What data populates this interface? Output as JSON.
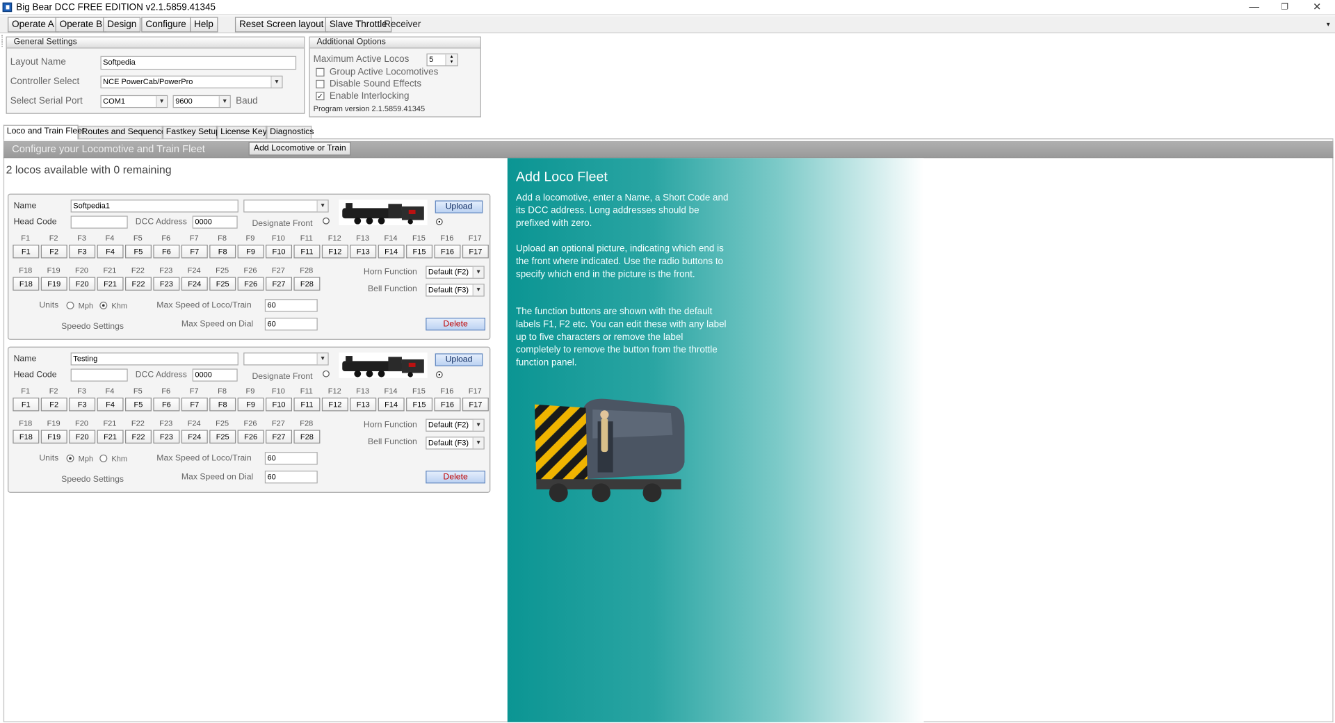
{
  "window": {
    "title": "Big Bear DCC FREE EDITION  v2.1.5859.41345",
    "controls": {
      "minimize": "—",
      "restore": "❐",
      "close": "✕"
    }
  },
  "menu": {
    "items": [
      "Operate A",
      "Operate B",
      "Design",
      "Configure",
      "Help"
    ],
    "reset": "Reset Screen layout",
    "slave": "Slave Throttle",
    "receiver": "Receiver"
  },
  "general": {
    "title": "General Settings",
    "layout_label": "Layout Name",
    "layout_value": "Softpedia",
    "controller_label": "Controller Select",
    "controller_value": "NCE PowerCab/PowerPro",
    "port_label": "Select Serial Port",
    "port_value": "COM1",
    "baud_value": "9600",
    "baud_label": "Baud"
  },
  "additional": {
    "title": "Additional Options",
    "max_label": "Maximum Active Locos",
    "max_value": "5",
    "group_label": "Group Active Locomotives",
    "group_checked": false,
    "sound_label": "Disable Sound Effects",
    "sound_checked": false,
    "interlock_label": "Enable Interlocking",
    "interlock_checked": true,
    "version": "Program version 2.1.5859.41345"
  },
  "tabs": [
    "Loco and Train Fleet",
    "Routes and Sequences",
    "Fastkey Setup",
    "License Keys",
    "Diagnostics"
  ],
  "config": {
    "title": "Configure your Locomotive and Train Fleet",
    "add_button": "Add Locomotive or Train",
    "available": "2 locos available with 0 remaining"
  },
  "labels": {
    "name": "Name",
    "head_code": "Head Code",
    "dcc": "DCC Address",
    "designate": "Designate Front",
    "horn": "Horn Function",
    "bell": "Bell Function",
    "units": "Units",
    "mph": "Mph",
    "khm": "Khm",
    "max_loco": "Max Speed of Loco/Train",
    "speedo": "Speedo Settings",
    "max_dial": "Max Speed on Dial",
    "upload": "Upload",
    "delete": "Delete"
  },
  "functions_row1": [
    "F1",
    "F2",
    "F3",
    "F4",
    "F5",
    "F6",
    "F7",
    "F8",
    "F9",
    "F10",
    "F11",
    "F12",
    "F13",
    "F14",
    "F15",
    "F16",
    "F17"
  ],
  "functions_row2": [
    "F18",
    "F19",
    "F20",
    "F21",
    "F22",
    "F23",
    "F24",
    "F25",
    "F26",
    "F27",
    "F28"
  ],
  "locos": [
    {
      "name": "Softpedia1",
      "head_code": "",
      "dcc": "0000",
      "horn": "Default (F2)",
      "bell": "Default (F3)",
      "unit": "Khm",
      "max_speed": "60",
      "max_dial": "60",
      "front": "right"
    },
    {
      "name": "Testing",
      "head_code": "",
      "dcc": "0000",
      "horn": "Default (F2)",
      "bell": "Default (F3)",
      "unit": "Mph",
      "max_speed": "60",
      "max_dial": "60",
      "front": "right"
    }
  ],
  "help": {
    "title": "Add Loco Fleet",
    "p1": "Add a locomotive, enter a Name, a Short Code and its DCC address. Long  addresses should be prefixed with zero.",
    "p2": "Upload an optional picture, indicating which end is the front where indicated. Use the radio buttons to specify which end in the picture is the front.",
    "p3": "The function buttons are shown with the default labels F1, F2 etc. You can edit these with any label up to five characters or remove the label completely to remove the button from the throttle function panel."
  }
}
